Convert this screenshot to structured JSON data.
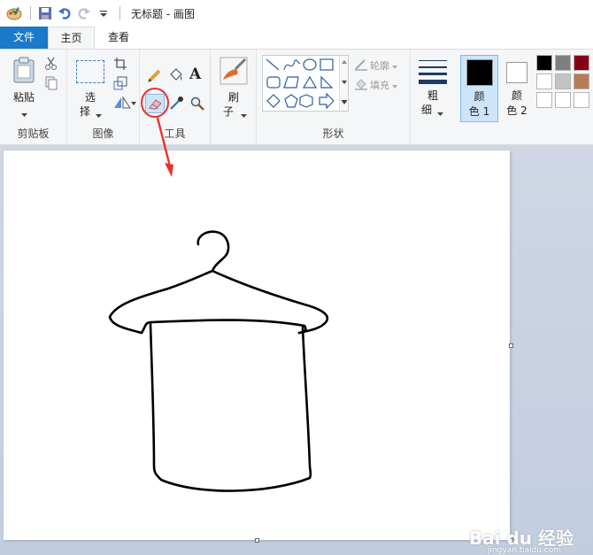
{
  "titlebar": {
    "title": "无标题 - 画图"
  },
  "tabs": {
    "file": "文件",
    "home": "主页",
    "view": "查看"
  },
  "ribbon": {
    "clipboard": {
      "paste": "粘贴",
      "group": "剪贴板"
    },
    "image": {
      "select_1": "选",
      "select_2": "择",
      "group": "图像"
    },
    "tools": {
      "group": "工具",
      "text_icon": "A"
    },
    "brush": {
      "label_1": "刷",
      "label_2": "子"
    },
    "shapes": {
      "outline": "轮廓",
      "fill": "填充",
      "group": "形状"
    },
    "size": {
      "label_1": "粗",
      "label_2": "细"
    },
    "color1": {
      "label_1": "颜",
      "label_2": "色 1",
      "color": "#000000"
    },
    "color2": {
      "label_1": "颜",
      "label_2": "色 2",
      "color": "#ffffff"
    },
    "palette": [
      "#000000",
      "#7f7f7f",
      "#880015",
      "#ffffff",
      "#c3c3c3",
      "#b97a57",
      "#ffffff",
      "#ffffff",
      "#ffffff"
    ]
  },
  "accent": {
    "annotation_red": "#e8322d",
    "file_tab_blue": "#1979ca"
  },
  "watermark": {
    "text": "Bai du 经验",
    "sub": "jingyan.baidu.com"
  }
}
